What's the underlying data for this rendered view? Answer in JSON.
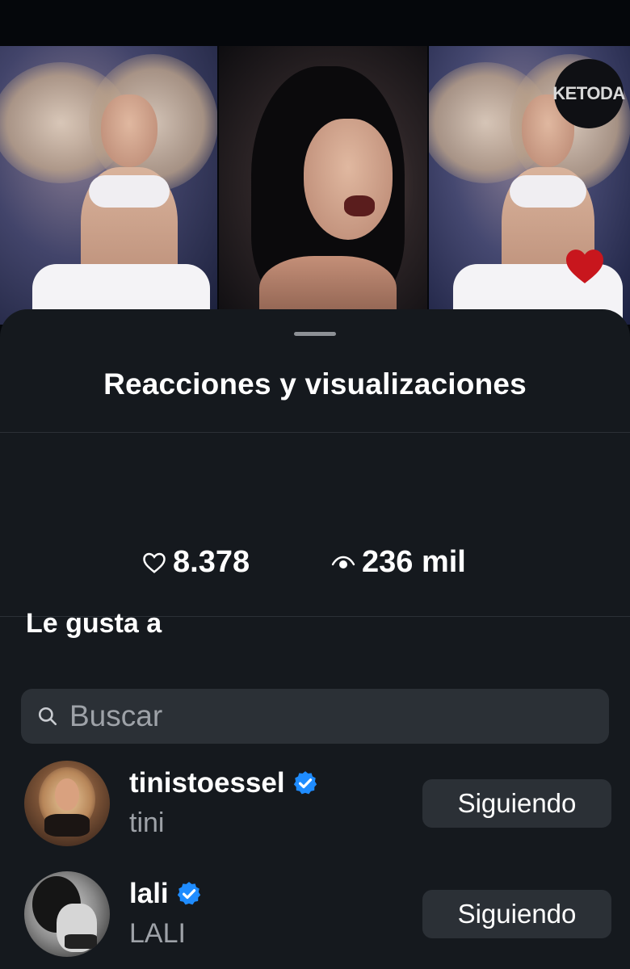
{
  "story_previews": {
    "watermark": "KETODA",
    "icons": [
      "heart-icon"
    ],
    "colors": {
      "heart": "#c8161d"
    }
  },
  "sheet": {
    "title": "Reacciones y visualizaciones",
    "stats": {
      "likes": "8.378",
      "likes_icon": "heart-outline-icon",
      "views": "236 mil",
      "views_icon": "eye-icon"
    },
    "likes_section_label": "Le gusta a",
    "search": {
      "placeholder": "Buscar",
      "value": "",
      "icon": "search-icon"
    },
    "users": [
      {
        "username": "tinistoessel",
        "display_name": "tini",
        "verified": true,
        "follow_label": "Siguiendo"
      },
      {
        "username": "lali",
        "display_name": "LALI",
        "verified": true,
        "follow_label": "Siguiendo"
      }
    ]
  },
  "colors": {
    "background": "#05070b",
    "sheet_bg": "#15191e",
    "control_bg": "#2b3036",
    "secondary_text": "#9ea2a8",
    "verified_blue": "#1f8cff"
  }
}
